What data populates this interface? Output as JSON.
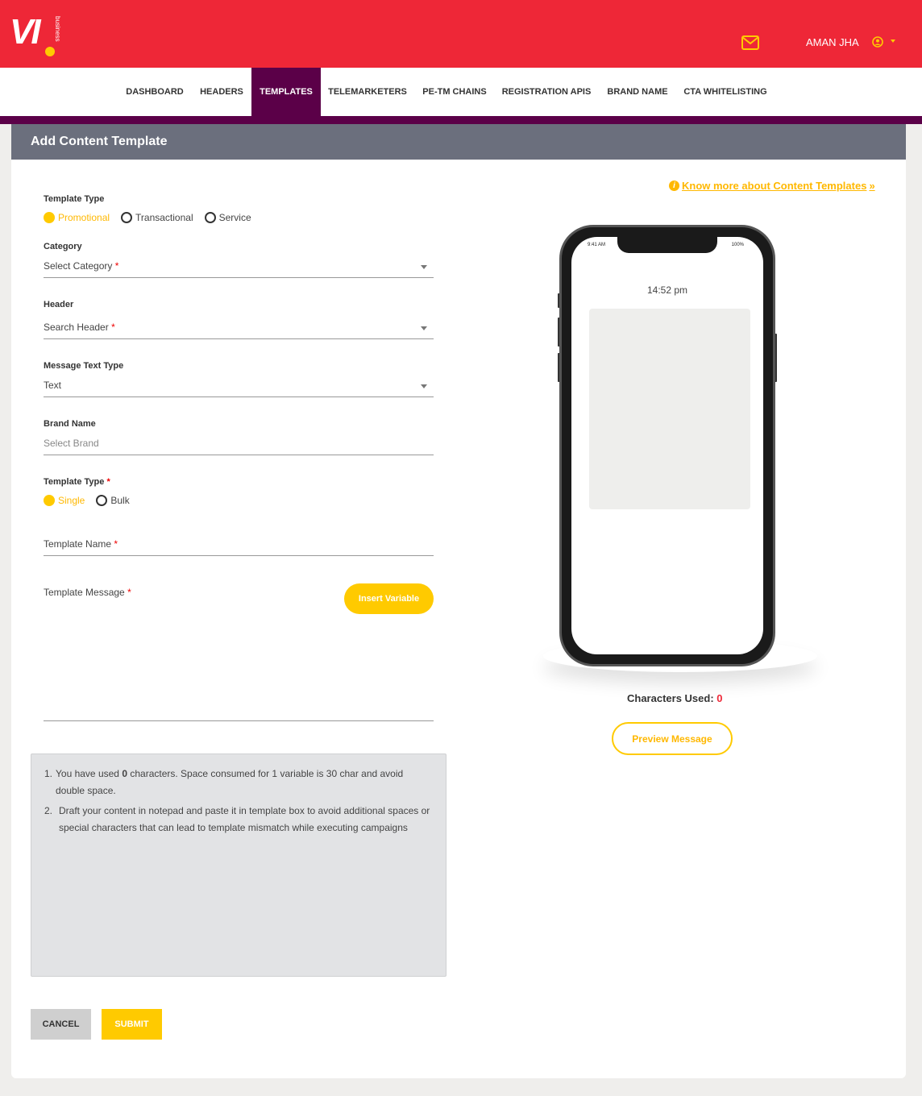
{
  "brand": {
    "logo_text": "VI",
    "logo_sub": "business",
    "accent": "#ee2737",
    "yellow": "#ffca00",
    "nav_active": "#5b0048"
  },
  "header": {
    "user_name": "AMAN JHA",
    "icons": [
      "mail-icon",
      "user-circle-icon",
      "caret-down-icon"
    ]
  },
  "nav": {
    "items": [
      {
        "label": "DASHBOARD"
      },
      {
        "label": "HEADERS"
      },
      {
        "label": "TEMPLATES",
        "active": true
      },
      {
        "label": "TELEMARKETERS"
      },
      {
        "label": "PE-TM CHAINS"
      },
      {
        "label": "REGISTRATION APIS"
      },
      {
        "label": "BRAND NAME"
      },
      {
        "label": "CTA WHITELISTING"
      }
    ]
  },
  "page": {
    "title": "Add Content Template"
  },
  "form": {
    "template_type": {
      "label": "Template Type",
      "options": [
        "Promotional",
        "Transactional",
        "Service"
      ],
      "selected": "Promotional"
    },
    "category": {
      "label": "Category",
      "placeholder": "Select Category",
      "required_mark": "*"
    },
    "header_field": {
      "label": "Header",
      "placeholder": "Search Header",
      "required_mark": "*"
    },
    "message_text_type": {
      "label": "Message Text Type",
      "value": "Text"
    },
    "brand_name": {
      "label": "Brand Name",
      "placeholder": "Select Brand"
    },
    "template_mode": {
      "label": "Template Type",
      "required_mark": "*",
      "options": [
        "Single",
        "Bulk"
      ],
      "selected": "Single"
    },
    "template_name": {
      "label": "Template Name",
      "required_mark": "*"
    },
    "template_message": {
      "label": "Template Message",
      "required_mark": "*"
    },
    "insert_variable_label": "Insert Variable"
  },
  "info": {
    "item1": {
      "num": "1.",
      "pre": "You have used",
      "count": "0",
      "post": "characters. Space consumed for 1 variable is 30 char and avoid double space."
    },
    "item2": {
      "num": "2.",
      "text": "Draft your content in notepad and paste it in template box to avoid additional spaces or special characters that can lead to template mismatch while executing campaigns"
    }
  },
  "actions": {
    "cancel": "CANCEL",
    "submit": "SUBMIT"
  },
  "preview": {
    "know_more": "Know more about Content Templates",
    "know_more_chevron": "»",
    "info_icon_glyph": "i",
    "status_time": "9:41 AM",
    "status_battery": "100%",
    "clock": "14:52 pm",
    "chars_used_label": "Characters Used:",
    "chars_used_value": "0",
    "preview_button": "Preview Message"
  }
}
